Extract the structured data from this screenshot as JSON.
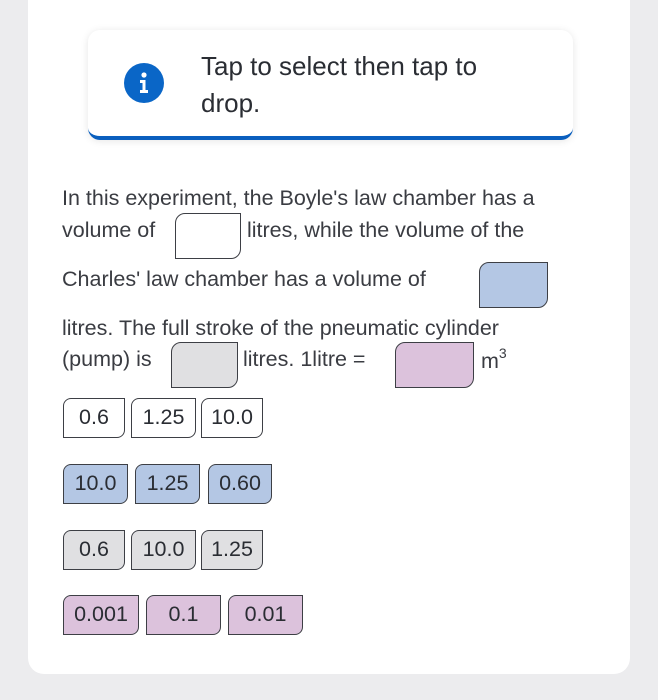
{
  "instruction": {
    "text": "Tap to select then tap to drop.",
    "icon": "info-icon"
  },
  "paragraph": {
    "line1": "In this experiment, the Boyle's law chamber has a",
    "line2_a": "volume of",
    "line2_b": "litres, while the volume of the",
    "line3": "Charles' law chamber has a volume of",
    "line4": "litres.  The full stroke of the pneumatic cylinder",
    "line5_a": "(pump) is",
    "line5_b": "litres.  1litre =",
    "unit_base": "m",
    "unit_exp": "3"
  },
  "option_groups": [
    {
      "color": "white",
      "options": [
        "0.6",
        "1.25",
        "10.0"
      ]
    },
    {
      "color": "blue",
      "options": [
        "10.0",
        "1.25",
        "0.60"
      ]
    },
    {
      "color": "gray",
      "options": [
        "0.6",
        "10.0",
        "1.25"
      ]
    },
    {
      "color": "pink",
      "options": [
        "0.001",
        "0.1",
        "0.01"
      ]
    }
  ],
  "colors": {
    "accent": "#0a66c7",
    "blue_slot": "#b4c7e4",
    "gray_slot": "#e0e0e2",
    "pink_slot": "#dcc2dc"
  }
}
